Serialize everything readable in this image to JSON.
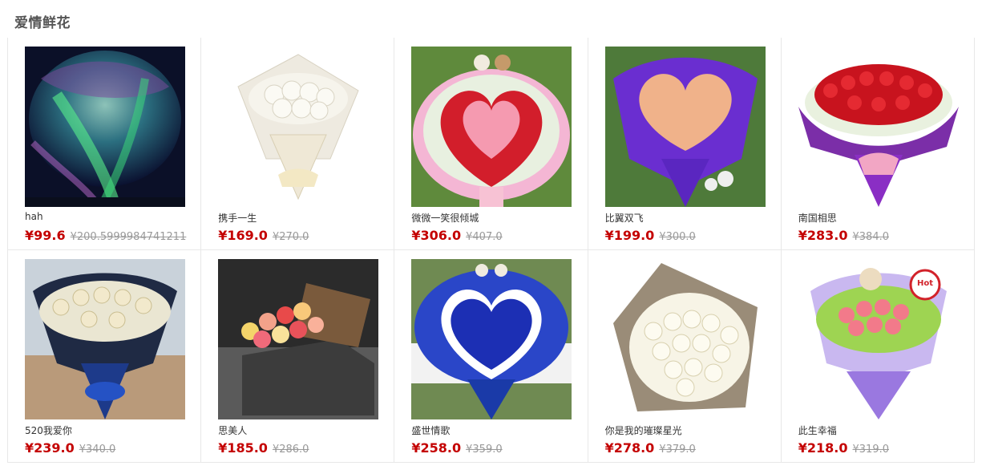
{
  "section": {
    "title": "爱情鲜花"
  },
  "currency": "¥",
  "products": [
    {
      "name": "hah",
      "price": "¥99.6",
      "old_price": "¥200.5999984741211",
      "image": "aurora-photo"
    },
    {
      "name": "携手一生",
      "price": "¥169.0",
      "old_price": "¥270.0",
      "image": "white-rose-bouquet-photo"
    },
    {
      "name": "微微一笑很倾城",
      "price": "¥306.0",
      "old_price": "¥407.0",
      "image": "heart-rose-bouquet-photo"
    },
    {
      "name": "比翼双飞",
      "price": "¥199.0",
      "old_price": "¥300.0",
      "image": "peach-rose-purple-wrap-photo"
    },
    {
      "name": "南国相思",
      "price": "¥283.0",
      "old_price": "¥384.0",
      "image": "red-rose-bouquet-photo"
    },
    {
      "name": "520我爱你",
      "price": "¥239.0",
      "old_price": "¥340.0",
      "image": "champagne-rose-dark-wrap-photo"
    },
    {
      "name": "思美人",
      "price": "¥185.0",
      "old_price": "¥286.0",
      "image": "rose-box-photo"
    },
    {
      "name": "盛世情歌",
      "price": "¥258.0",
      "old_price": "¥359.0",
      "image": "blue-rose-heart-photo"
    },
    {
      "name": "你是我的璀璨星光",
      "price": "¥278.0",
      "old_price": "¥379.0",
      "image": "white-rose-kraft-wrap-photo"
    },
    {
      "name": "此生幸福",
      "price": "¥218.0",
      "old_price": "¥319.0",
      "image": "pink-rose-teddy-hot-badge-photo"
    }
  ],
  "colors": {
    "price": "#c40000",
    "old_price": "#999999",
    "title": "#555555",
    "border": "#e8e8e8"
  }
}
